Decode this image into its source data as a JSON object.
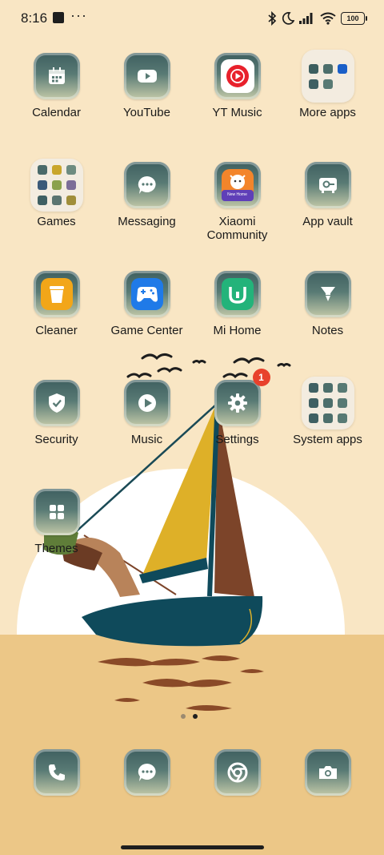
{
  "status_bar": {
    "time": "8:16",
    "overflow": "···",
    "battery": "100",
    "icons": [
      "bluetooth-icon",
      "moon-icon",
      "signal-icon",
      "wifi-icon",
      "battery-icon"
    ]
  },
  "apps": [
    {
      "label": "Calendar",
      "icon": "calendar-icon"
    },
    {
      "label": "YouTube",
      "icon": "youtube-icon"
    },
    {
      "label": "YT Music",
      "icon": "yt-music-icon"
    },
    {
      "label": "More apps",
      "icon": "folder-icon"
    },
    {
      "label": "Games",
      "icon": "folder-icon"
    },
    {
      "label": "Messaging",
      "icon": "messaging-icon"
    },
    {
      "label": "Xiaomi Community",
      "icon": "xiaomi-community-icon",
      "icon_text": "New Home"
    },
    {
      "label": "App vault",
      "icon": "app-vault-icon"
    },
    {
      "label": "Cleaner",
      "icon": "cleaner-icon"
    },
    {
      "label": "Game Center",
      "icon": "game-center-icon"
    },
    {
      "label": "Mi Home",
      "icon": "mi-home-icon"
    },
    {
      "label": "Notes",
      "icon": "notes-icon"
    },
    {
      "label": "Security",
      "icon": "security-icon"
    },
    {
      "label": "Music",
      "icon": "music-icon"
    },
    {
      "label": "Settings",
      "icon": "settings-icon",
      "badge": "1"
    },
    {
      "label": "System apps",
      "icon": "folder-icon"
    },
    {
      "label": "Themes",
      "icon": "themes-icon"
    }
  ],
  "page_indicator": {
    "pages": 2,
    "current": 2
  },
  "dock": [
    {
      "icon": "phone-icon"
    },
    {
      "icon": "messaging-icon"
    },
    {
      "icon": "chrome-icon"
    },
    {
      "icon": "camera-icon"
    }
  ],
  "colors": {
    "background": "#f9e6c4",
    "sand": "#ecc787",
    "boat": "#0f4a5b",
    "sail_yellow": "#deb028",
    "sail_brown": "#7c4429",
    "badge": "#e8412c"
  }
}
